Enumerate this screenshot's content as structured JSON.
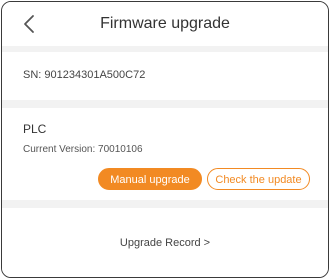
{
  "header": {
    "title": "Firmware upgrade",
    "back_icon": "chevron-left-icon"
  },
  "device": {
    "sn_label": "SN:",
    "sn_value": "901234301A500C72"
  },
  "plc": {
    "title": "PLC",
    "version_label": "Current Version:",
    "version_value": "70010106",
    "manual_upgrade_label": "Manual upgrade",
    "check_update_label": "Check the update"
  },
  "footer": {
    "upgrade_record_label": "Upgrade Record >"
  },
  "colors": {
    "accent": "#f28a23",
    "background": "#f2f2f2",
    "card": "#ffffff"
  }
}
